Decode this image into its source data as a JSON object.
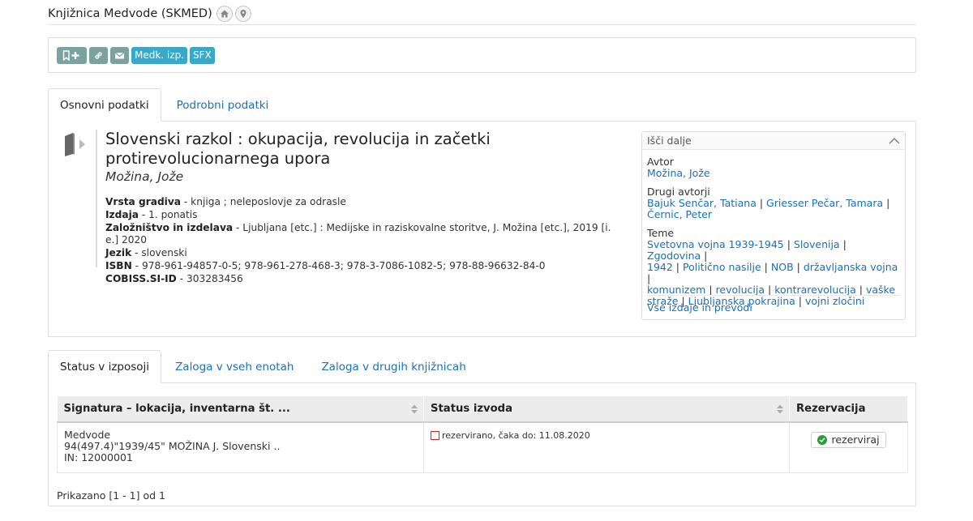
{
  "header": {
    "title": "Knjižnica Medvode (SKMED)",
    "icons": [
      "home-icon",
      "location-icon"
    ]
  },
  "toolbar": {
    "medk_label": "Medk. izp.",
    "sfx_label": "SFX",
    "icons": [
      "bookmark-add-icon",
      "link-icon",
      "mail-icon"
    ]
  },
  "tabs_top": {
    "basic": "Osnovni podatki",
    "detailed": "Podrobni podatki"
  },
  "record": {
    "title": "Slovenski razkol : okupacija, revolucija in začetki protirevolucionarnega upora",
    "author": "Možina, Jože",
    "fields": [
      {
        "label": "Vrsta gradiva",
        "value": " - knjiga ; neleposlovje za odrasle"
      },
      {
        "label": "Izdaja",
        "value": " - 1. ponatis"
      },
      {
        "label": "Založništvo in izdelava",
        "value": " - Ljubljana [etc.] : Medijske in raziskovalne storitve, J. Možina [etc.], 2019 [i. e.] 2020"
      },
      {
        "label": "Jezik",
        "value": " - slovenski"
      },
      {
        "label": "ISBN",
        "value": " - 978-961-94857-0-5; 978-961-278-468-3; 978-3-7086-1082-5; 978-88-96632-84-0"
      },
      {
        "label": "COBISS.SI-ID",
        "value": " - 303283456"
      }
    ]
  },
  "side": {
    "header": "Išči dalje",
    "author_label": "Avtor",
    "author": "Možina, Jože",
    "other_authors_label": "Drugi avtorji",
    "other_authors": [
      "Bajuk Senčar, Tatiana",
      "Griesser Pečar, Tamara",
      "Černic, Peter"
    ],
    "topics_label": "Teme",
    "topics": [
      "Svetovna vojna 1939-1945",
      "Slovenija",
      "Zgodovina",
      "1942",
      "Politično nasilje",
      "NOB",
      "državljanska vojna",
      "komunizem",
      "revolucija",
      "kontrarevolucija",
      "vaške straže",
      "Ljubljanska pokrajina",
      "vojni zločini"
    ],
    "all_editions": "Vse izdaje in prevodi"
  },
  "tabs_bottom": {
    "loan": "Status v izposoji",
    "all_units": "Zaloga v vseh enotah",
    "other_libs": "Zaloga v drugih knjižnicah"
  },
  "holdings": {
    "col_signature": "Signatura – lokacija, inventarna št. ...",
    "col_status": "Status izvoda",
    "col_reserve": "Rezervacija",
    "rows": [
      {
        "location": "Medvode",
        "signature": "94(497.4)\"1939/45\" MOŽINA J. Slovenski ..",
        "inventory": "IN: 12000001",
        "status": "rezervirano, čaka do: 11.08.2020",
        "reserve_label": "rezerviraj"
      }
    ],
    "count": "Prikazano [1 - 1] od 1"
  },
  "colors": {
    "link": "#1a6fbf",
    "toolbar_gray": "#7aa3a0",
    "toolbar_blue": "#3aa9c8",
    "status_red": "#dd2222",
    "ok_green": "#2a9d3a"
  }
}
